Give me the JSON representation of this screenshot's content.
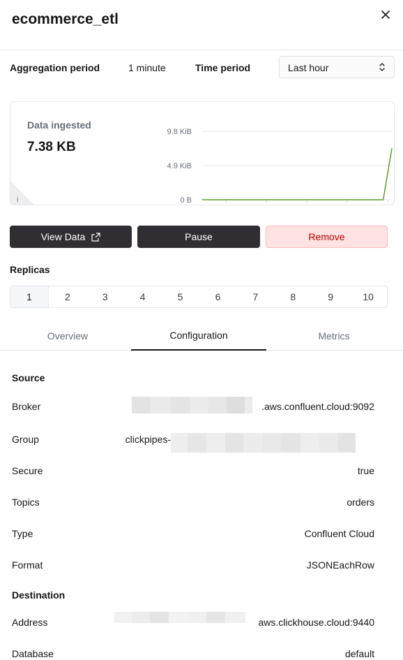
{
  "header": {
    "title": "ecommerce_etl",
    "close_icon": "close-icon"
  },
  "aggregation": {
    "label": "Aggregation period",
    "value": "1 minute",
    "time_label": "Time period",
    "time_value": "Last hour"
  },
  "metric_card": {
    "label": "Data ingested",
    "value": "7.38 KB",
    "info_icon": "i"
  },
  "chart_data": {
    "type": "line",
    "y_ticks": [
      "9.8 KiB",
      "4.9 KiB",
      "0 B"
    ],
    "ylim": [
      0,
      9.8
    ],
    "series": [
      {
        "values": [
          0,
          0,
          0,
          0,
          0,
          0,
          0,
          0,
          0,
          0,
          0,
          0,
          0,
          0,
          0,
          0,
          0,
          0,
          0,
          0,
          0,
          0,
          7.38
        ]
      }
    ],
    "color": "#5a9b2a",
    "grid": true
  },
  "actions": {
    "view_data": "View Data",
    "pause": "Pause",
    "remove": "Remove"
  },
  "replicas": {
    "label": "Replicas",
    "items": [
      "1",
      "2",
      "3",
      "4",
      "5",
      "6",
      "7",
      "8",
      "9",
      "10"
    ],
    "selected": "1"
  },
  "tabs": [
    "Overview",
    "Configuration",
    "Metrics"
  ],
  "active_tab": "Configuration",
  "source": {
    "title": "Source",
    "broker_label": "Broker",
    "broker_value": ".aws.confluent.cloud:9092",
    "group_label": "Group",
    "group_value": "clickpipes-",
    "secure_label": "Secure",
    "secure_value": "true",
    "topics_label": "Topics",
    "topics_value": "orders",
    "type_label": "Type",
    "type_value": "Confluent Cloud",
    "format_label": "Format",
    "format_value": "JSONEachRow"
  },
  "destination": {
    "title": "Destination",
    "address_label": "Address",
    "address_value": "aws.clickhouse.cloud:9440",
    "database_label": "Database",
    "database_value": "default"
  }
}
